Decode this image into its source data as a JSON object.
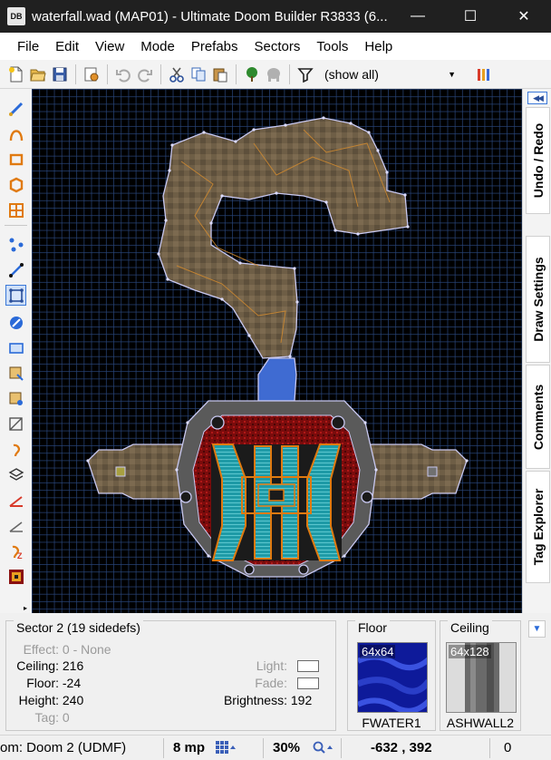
{
  "window": {
    "title": "waterfall.wad (MAP01) - Ultimate Doom Builder R3833 (6...",
    "app_icon_text": "DB",
    "controls": {
      "minimize": "—",
      "maximize": "☐",
      "close": "✕"
    }
  },
  "menubar": {
    "items": [
      "File",
      "Edit",
      "View",
      "Mode",
      "Prefabs",
      "Sectors",
      "Tools",
      "Help"
    ]
  },
  "toolbar": {
    "filter_value": "(show all)",
    "icons": [
      "new-map-icon",
      "open-map-icon",
      "save-map-icon",
      "map-options-icon",
      "undo-icon",
      "redo-icon",
      "cut-icon",
      "copy-icon",
      "paste-icon",
      "things-tree-icon",
      "things-monster-icon",
      "filter-icon",
      "test-map-icon"
    ]
  },
  "toolbox": {
    "tools": [
      "draw-lines-icon",
      "draw-curve-icon",
      "draw-rectangle-icon",
      "draw-ellipse-icon",
      "draw-grid-icon",
      "vertices-mode-icon",
      "linedefs-mode-icon",
      "sectors-mode-icon",
      "things-mode-icon",
      "visual-mode-icon",
      "make-sector-icon",
      "edit-sectors-icon",
      "edit-linedefs-icon",
      "sound-propagation-icon",
      "layers-icon",
      "slope-angle-icon",
      "slope-line-icon",
      "make-doors-icon",
      "texture-browser-icon"
    ],
    "active_tool": "sectors-mode-icon"
  },
  "docker": {
    "collapse_glyph": "◀◀",
    "tabs": [
      "Undo / Redo",
      "Draw Settings",
      "Comments",
      "Tag Explorer"
    ]
  },
  "colors": {
    "grid_line": "#284478",
    "canvas_bg": "#000000",
    "linedef": "#c8c8f0",
    "vertex": "#dcdcff",
    "selection": "#3b78d8",
    "water_teal": "#1e9aa6",
    "lava_red": "#8a1010",
    "stone_brown": "#6e5e46"
  },
  "info": {
    "sector_title": "Sector 2 (19 sidedefs)",
    "effect_label": "Effect:",
    "effect_value": "0 - None",
    "ceiling_label": "Ceiling:",
    "ceiling_value": "216",
    "floor_label": "Floor:",
    "floor_value": "-24",
    "height_label": "Height:",
    "height_value": "240",
    "tag_label": "Tag:",
    "tag_value": "0",
    "light_label": "Light:",
    "fade_label": "Fade:",
    "brightness_label": "Brightness:",
    "brightness_value": "192",
    "floor_texture": {
      "group": "Floor",
      "size": "64x64",
      "name": "FWATER1"
    },
    "ceiling_texture": {
      "group": "Ceiling",
      "size": "64x128",
      "name": "ASHWALL2"
    }
  },
  "status": {
    "config": "om: Doom 2 (UDMF)",
    "grid_size": "8 mp",
    "zoom": "30%",
    "coordinates": "-632 , 392",
    "tail_value": "0"
  }
}
